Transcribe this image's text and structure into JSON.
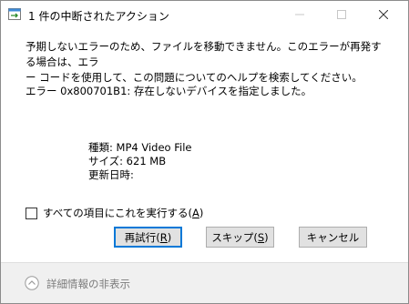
{
  "window": {
    "title": "1 件の中断されたアクション"
  },
  "titlebar": {
    "minimize_icon": "minimize-icon",
    "maximize_icon": "maximize-icon",
    "close_icon": "close-icon"
  },
  "message": {
    "line1": "予期しないエラーのため、ファイルを移動できません。このエラーが再発する場合は、エラ",
    "line2": "ー コードを使用して、この問題についてのヘルプを検索してください。",
    "error_line": "エラー 0x800701B1: 存在しないデバイスを指定しました。"
  },
  "details": {
    "type": "種類: MP4 Video File",
    "size": "サイズ: 621 MB",
    "modified": "更新日時:"
  },
  "checkbox": {
    "label_main": "すべての項目にこれを実行する(",
    "label_key": "A",
    "label_end": ")",
    "checked": false
  },
  "buttons": {
    "retry_main": "再試行(",
    "retry_key": "R",
    "skip_main": "スキップ(",
    "skip_key": "S",
    "close_paren": ")",
    "cancel": "キャンセル"
  },
  "footer": {
    "label": "詳細情報の非表示",
    "icon": "chevron-up-circle-icon"
  },
  "colors": {
    "accent": "#0078d7",
    "footer_bg": "#f0f0f0",
    "button_bg": "#e1e1e1"
  }
}
